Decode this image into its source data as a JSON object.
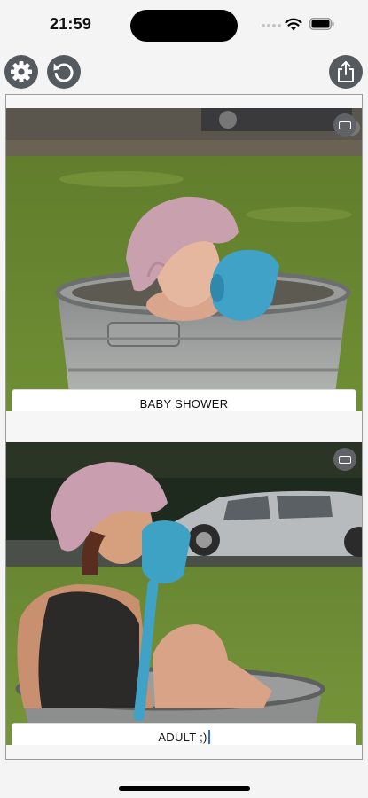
{
  "status_bar": {
    "time": "21:59"
  },
  "toolbar": {
    "settings_icon": "gear-icon",
    "reset_icon": "rotate-left-icon",
    "share_icon": "share-icon"
  },
  "panels": [
    {
      "caption": "BABY SHOWER",
      "aspect_icon": "aspect-ratio-icon"
    },
    {
      "caption": "ADULT ;)",
      "aspect_icon": "aspect-ratio-icon"
    }
  ],
  "colors": {
    "background": "#f4f4f4",
    "button_gray": "#555a5f",
    "cursor_blue": "#2a6bf2"
  }
}
